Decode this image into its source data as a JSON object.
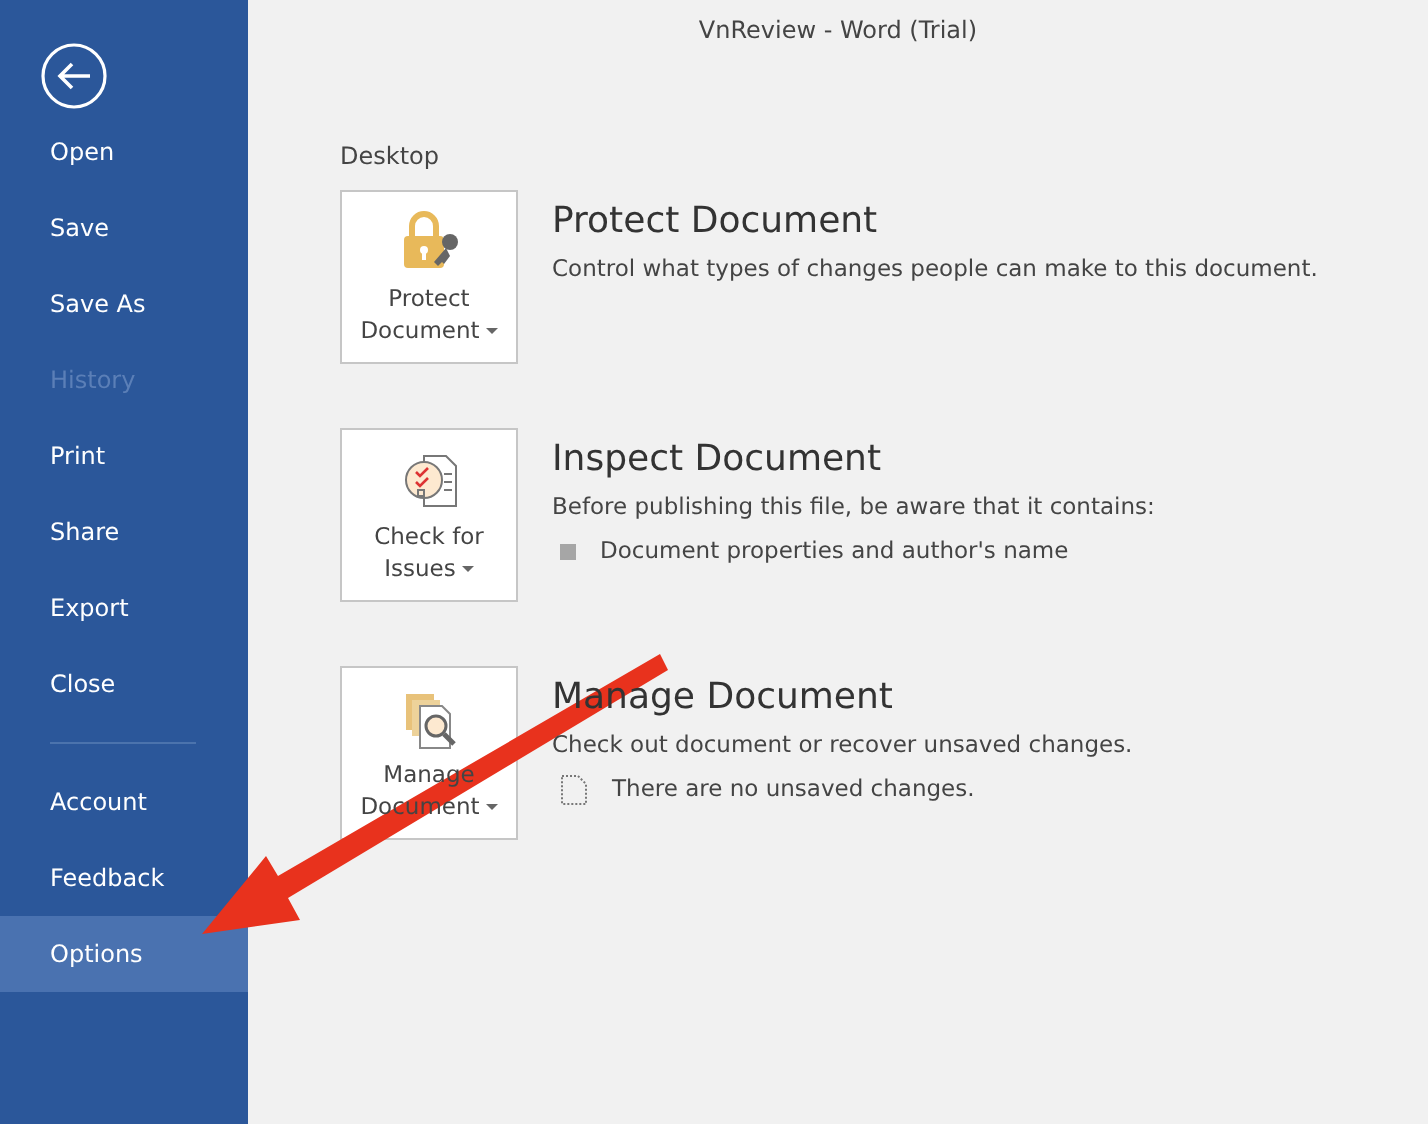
{
  "window": {
    "title": "VnReview  -  Word (Trial)"
  },
  "sidebar": {
    "items": [
      {
        "label": "Open",
        "disabled": false,
        "selected": false
      },
      {
        "label": "Save",
        "disabled": false,
        "selected": false
      },
      {
        "label": "Save As",
        "disabled": false,
        "selected": false
      },
      {
        "label": "History",
        "disabled": true,
        "selected": false
      },
      {
        "label": "Print",
        "disabled": false,
        "selected": false
      },
      {
        "label": "Share",
        "disabled": false,
        "selected": false
      },
      {
        "label": "Export",
        "disabled": false,
        "selected": false
      },
      {
        "label": "Close",
        "disabled": false,
        "selected": false
      }
    ],
    "bottom_items": [
      {
        "label": "Account",
        "disabled": false,
        "selected": false
      },
      {
        "label": "Feedback",
        "disabled": false,
        "selected": false
      },
      {
        "label": "Options",
        "disabled": false,
        "selected": true
      }
    ]
  },
  "section_label": "Desktop",
  "sections": [
    {
      "kind": "protect",
      "button_lines": [
        "Protect",
        "Document"
      ],
      "title": "Protect Document",
      "description": "Control what types of changes people can make to this document."
    },
    {
      "kind": "inspect",
      "button_lines": [
        "Check for",
        "Issues"
      ],
      "title": "Inspect Document",
      "description": "Before publishing this file, be aware that it contains:",
      "notes": [
        {
          "kind": "square",
          "text": "Document properties and author's name"
        }
      ]
    },
    {
      "kind": "manage",
      "button_lines": [
        "Manage",
        "Document"
      ],
      "title": "Manage Document",
      "description": "Check out document or recover unsaved changes.",
      "notes": [
        {
          "kind": "document",
          "text": "There are no unsaved changes."
        }
      ]
    }
  ]
}
